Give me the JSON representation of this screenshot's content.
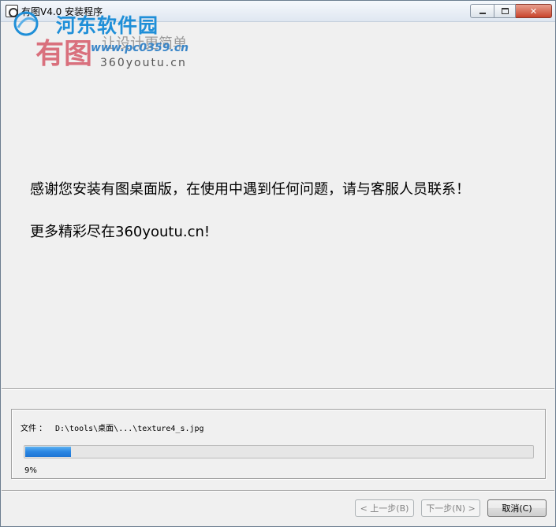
{
  "window": {
    "title": "有图V4.0 安装程序",
    "controls": {
      "minimize": "",
      "maximize": "",
      "close": "✕"
    }
  },
  "watermark": {
    "site_name": "河东软件园",
    "site_url": "www.pc0359.cn",
    "logo_text": "有图",
    "slogan": "让设计更简单",
    "domain": "360youtu.cn"
  },
  "content": {
    "message": "感谢您安装有图桌面版，在使用中遇到任何问题，请与客服人员联系！",
    "more": "更多精彩尽在360youtu.cn!"
  },
  "progress_group": {
    "file_label": "文件 ：",
    "file_path": "D:\\tools\\桌面\\...\\texture4_s.jpg",
    "percent_text": "9%",
    "progress": 0.09
  },
  "buttons": {
    "back": "< 上一步(B)",
    "next": "下一步(N) >",
    "cancel": "取消(C)"
  },
  "colors": {
    "progress_fill": "#2b86e2",
    "watermark_blue": "#1f8fd8"
  }
}
